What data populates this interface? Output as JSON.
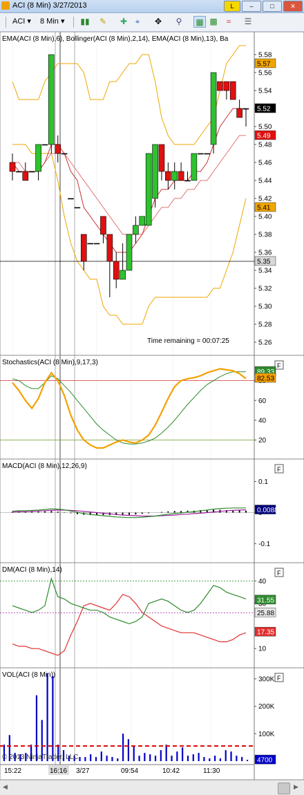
{
  "window": {
    "title": "ACI (8 Min)  3/27/2013",
    "help_label": "L"
  },
  "toolbar": {
    "instrument": "ACI",
    "interval": "8 Min"
  },
  "status": {
    "time_remaining": "Time remaining = 00:07:25",
    "copyright": "© 2013 NinjaTrader, LLC"
  },
  "colors": {
    "up": "#2ec22e",
    "down": "#e01010",
    "bollinger": "#f0a500",
    "ema6": "#c83030",
    "ema13": "#e07070",
    "stoch_k": "#f5a000",
    "stoch_d": "#2e8b2e",
    "dm_plus": "#2e8b2e",
    "dm_minus": "#e03030",
    "volume": "#0000c8",
    "vol_ma": "#e00000",
    "macd_line": "#2e8b2e",
    "macd_signal": "#a020a0"
  },
  "chart_data": {
    "type": "line",
    "x_tick_labels": [
      "15:22",
      "16:16",
      "3/27",
      "09:54",
      "10:42",
      "11:30"
    ],
    "panels": [
      {
        "name": "price",
        "label": "EMA(ACI (8 Min),6), Bollinger(ACI (8 Min),2,14), EMA(ACI (8 Min),13), Ba",
        "ylim": [
          5.25,
          5.59
        ],
        "yticks": [
          "5.58",
          "5.56",
          "5.54",
          "5.52",
          "5.50",
          "5.48",
          "5.46",
          "5.44",
          "5.42",
          "5.40",
          "5.38",
          "5.36",
          "5.34",
          "5.32",
          "5.30",
          "5.28",
          "5.26"
        ],
        "value_labels": [
          {
            "text": "5.57",
            "value": 5.57,
            "color": "#f0a500"
          },
          {
            "text": "5.52",
            "value": 5.52,
            "color": "#000000"
          },
          {
            "text": "5.49",
            "value": 5.49,
            "color": "#e01010"
          },
          {
            "text": "5.41",
            "value": 5.41,
            "color": "#f0a500"
          },
          {
            "text": "5.35",
            "value": 5.35,
            "color": "#d8d8d8"
          }
        ],
        "candles": [
          {
            "o": 5.46,
            "h": 5.47,
            "l": 5.44,
            "c": 5.45
          },
          {
            "o": 5.45,
            "h": 5.45,
            "l": 5.45,
            "c": 5.45
          },
          {
            "o": 5.45,
            "h": 5.46,
            "l": 5.44,
            "c": 5.44
          },
          {
            "o": 5.45,
            "h": 5.45,
            "l": 5.45,
            "c": 5.45
          },
          {
            "o": 5.45,
            "h": 5.48,
            "l": 5.44,
            "c": 5.48
          },
          {
            "o": 5.48,
            "h": 5.48,
            "l": 5.48,
            "c": 5.48
          },
          {
            "o": 5.48,
            "h": 5.58,
            "l": 5.47,
            "c": 5.58
          },
          {
            "o": 5.48,
            "h": 5.49,
            "l": 5.46,
            "c": 5.47
          },
          {
            "o": 5.47,
            "h": 5.47,
            "l": 5.47,
            "c": 5.47
          },
          {
            "o": 5.42,
            "h": 5.42,
            "l": 5.42,
            "c": 5.42
          },
          {
            "o": 5.41,
            "h": 5.41,
            "l": 5.41,
            "c": 5.41
          },
          {
            "o": 5.38,
            "h": 5.38,
            "l": 5.34,
            "c": 5.35
          },
          {
            "o": 5.37,
            "h": 5.37,
            "l": 5.37,
            "c": 5.37
          },
          {
            "o": 5.37,
            "h": 5.37,
            "l": 5.37,
            "c": 5.37
          },
          {
            "o": 5.4,
            "h": 5.4,
            "l": 5.37,
            "c": 5.38
          },
          {
            "o": 5.38,
            "h": 5.38,
            "l": 5.31,
            "c": 5.35
          },
          {
            "o": 5.35,
            "h": 5.36,
            "l": 5.32,
            "c": 5.33
          },
          {
            "o": 5.33,
            "h": 5.37,
            "l": 5.33,
            "c": 5.34
          },
          {
            "o": 5.34,
            "h": 5.38,
            "l": 5.34,
            "c": 5.38
          },
          {
            "o": 5.38,
            "h": 5.4,
            "l": 5.37,
            "c": 5.39
          },
          {
            "o": 5.39,
            "h": 5.4,
            "l": 5.39,
            "c": 5.4
          },
          {
            "o": 5.39,
            "h": 5.47,
            "l": 5.39,
            "c": 5.47
          },
          {
            "o": 5.42,
            "h": 5.48,
            "l": 5.41,
            "c": 5.48
          },
          {
            "o": 5.48,
            "h": 5.48,
            "l": 5.44,
            "c": 5.45
          },
          {
            "o": 5.45,
            "h": 5.46,
            "l": 5.43,
            "c": 5.44
          },
          {
            "o": 5.44,
            "h": 5.46,
            "l": 5.43,
            "c": 5.45
          },
          {
            "o": 5.45,
            "h": 5.46,
            "l": 5.44,
            "c": 5.44
          },
          {
            "o": 5.44,
            "h": 5.45,
            "l": 5.44,
            "c": 5.44
          },
          {
            "o": 5.44,
            "h": 5.47,
            "l": 5.44,
            "c": 5.47
          },
          {
            "o": 5.47,
            "h": 5.47,
            "l": 5.47,
            "c": 5.47
          },
          {
            "o": 5.47,
            "h": 5.47,
            "l": 5.47,
            "c": 5.47
          },
          {
            "o": 5.48,
            "h": 5.56,
            "l": 5.47,
            "c": 5.56
          },
          {
            "o": 5.55,
            "h": 5.55,
            "l": 5.54,
            "c": 5.54
          },
          {
            "o": 5.55,
            "h": 5.55,
            "l": 5.53,
            "c": 5.54
          },
          {
            "o": 5.55,
            "h": 5.55,
            "l": 5.53,
            "c": 5.53
          },
          {
            "o": 5.52,
            "h": 5.53,
            "l": 5.51,
            "c": 5.51
          },
          {
            "o": 5.52,
            "h": 5.52,
            "l": 5.5,
            "c": 5.52
          }
        ],
        "bollinger_upper": [
          5.55,
          5.53,
          5.53,
          5.53,
          5.53,
          5.55,
          5.56,
          5.57,
          5.57,
          5.57,
          5.57,
          5.56,
          5.53,
          5.53,
          5.53,
          5.55,
          5.55,
          5.56,
          5.57,
          5.57,
          5.58,
          5.58,
          5.55,
          5.51,
          5.49,
          5.48,
          5.48,
          5.48,
          5.48,
          5.49,
          5.5,
          5.51,
          5.54,
          5.57,
          5.58,
          5.59,
          5.59
        ],
        "bollinger_lower": [
          5.48,
          5.48,
          5.48,
          5.47,
          5.47,
          5.47,
          5.47,
          5.44,
          5.4,
          5.37,
          5.35,
          5.34,
          5.33,
          5.33,
          5.3,
          5.29,
          5.29,
          5.28,
          5.28,
          5.28,
          5.28,
          5.3,
          5.31,
          5.31,
          5.31,
          5.31,
          5.31,
          5.31,
          5.31,
          5.31,
          5.31,
          5.32,
          5.32,
          5.34,
          5.36,
          5.39,
          5.42
        ],
        "ema_6": [
          5.46,
          5.45,
          5.45,
          5.45,
          5.45,
          5.46,
          5.48,
          5.48,
          5.47,
          5.45,
          5.44,
          5.41,
          5.4,
          5.39,
          5.38,
          5.37,
          5.36,
          5.36,
          5.36,
          5.37,
          5.38,
          5.4,
          5.42,
          5.43,
          5.43,
          5.44,
          5.44,
          5.44,
          5.45,
          5.45,
          5.46,
          5.48,
          5.5,
          5.51,
          5.52,
          5.52,
          5.52
        ],
        "ema_13": [
          5.46,
          5.46,
          5.45,
          5.45,
          5.45,
          5.46,
          5.47,
          5.47,
          5.47,
          5.46,
          5.45,
          5.44,
          5.43,
          5.42,
          5.41,
          5.4,
          5.39,
          5.38,
          5.38,
          5.38,
          5.38,
          5.39,
          5.4,
          5.41,
          5.41,
          5.42,
          5.42,
          5.43,
          5.43,
          5.44,
          5.44,
          5.45,
          5.46,
          5.47,
          5.48,
          5.49,
          5.49
        ],
        "horizontal_line": 5.35
      },
      {
        "name": "stochastics",
        "label": "Stochastics(ACI (8 Min),9,17,3)",
        "ylim": [
          5,
          100
        ],
        "yticks": [
          "80",
          "60",
          "40",
          "20"
        ],
        "value_labels": [
          {
            "text": "89.33",
            "value": 89.33,
            "color": "#2e8b2e"
          },
          {
            "text": "82.53",
            "value": 82.53,
            "color": "#f5a000"
          }
        ],
        "levels": [
          80,
          20
        ],
        "k": [
          78,
          70,
          60,
          52,
          62,
          78,
          88,
          80,
          65,
          45,
          30,
          20,
          15,
          12,
          12,
          15,
          18,
          20,
          18,
          17,
          20,
          25,
          35,
          48,
          62,
          74,
          80,
          82,
          83,
          85,
          88,
          90,
          92,
          91,
          90,
          87,
          82
        ],
        "d": [
          82,
          80,
          75,
          72,
          72,
          78,
          85,
          82,
          75,
          68,
          60,
          52,
          44,
          36,
          30,
          25,
          20,
          17,
          16,
          16,
          17,
          19,
          22,
          27,
          33,
          40,
          48,
          56,
          63,
          70,
          76,
          80,
          84,
          87,
          89,
          89,
          89
        ]
      },
      {
        "name": "macd",
        "label": "MACD(ACI (8 Min),12,26,9)",
        "ylim": [
          -0.15,
          0.15
        ],
        "yticks": [
          "0.1",
          "0",
          "-0.1"
        ],
        "value_labels": [
          {
            "text": "0.00881",
            "value": 0.00881,
            "color": "#00007a"
          }
        ],
        "macd": [
          0.005,
          0.006,
          0.006,
          0.007,
          0.008,
          0.01,
          0.012,
          0.011,
          0.009,
          0.005,
          0.001,
          -0.003,
          -0.006,
          -0.008,
          -0.01,
          -0.012,
          -0.014,
          -0.015,
          -0.016,
          -0.016,
          -0.015,
          -0.013,
          -0.011,
          -0.008,
          -0.005,
          -0.003,
          -0.001,
          0.001,
          0.003,
          0.006,
          0.008,
          0.011,
          0.013,
          0.014,
          0.015,
          0.015,
          0.015
        ],
        "signal": [
          0.002,
          0.003,
          0.003,
          0.004,
          0.005,
          0.006,
          0.007,
          0.008,
          0.008,
          0.007,
          0.006,
          0.004,
          0.002,
          0.0,
          -0.002,
          -0.004,
          -0.006,
          -0.008,
          -0.009,
          -0.01,
          -0.011,
          -0.011,
          -0.011,
          -0.01,
          -0.009,
          -0.008,
          -0.006,
          -0.005,
          -0.003,
          -0.002,
          0.0,
          0.002,
          0.004,
          0.006,
          0.007,
          0.008,
          0.009
        ]
      },
      {
        "name": "dm",
        "label": "DM(ACI (8 Min),14)",
        "ylim": [
          3,
          45
        ],
        "yticks": [
          "40",
          "30",
          "10"
        ],
        "value_labels": [
          {
            "text": "31.55",
            "value": 31.55,
            "color": "#2e8b2e"
          },
          {
            "text": "25.88",
            "value": 25.88,
            "color": "#e8e8e8"
          },
          {
            "text": "17.35",
            "value": 17.35,
            "color": "#e03030"
          }
        ],
        "levels": [
          40,
          25.88
        ],
        "dm_plus": [
          29,
          28,
          27,
          26,
          27,
          29,
          41,
          33,
          32,
          30,
          29,
          28,
          27,
          27,
          26,
          24,
          23,
          22,
          21,
          22,
          24,
          30,
          31,
          32,
          31,
          29,
          27,
          26,
          27,
          30,
          34,
          38,
          37,
          35,
          34,
          33,
          32
        ],
        "dm_minus": [
          12,
          11,
          11,
          10,
          10,
          9,
          8,
          7,
          9,
          16,
          22,
          29,
          30,
          29,
          28,
          27,
          30,
          34,
          33,
          30,
          26,
          24,
          22,
          20,
          19,
          18,
          17,
          17,
          17,
          16,
          15,
          14,
          13,
          13,
          14,
          16,
          17
        ]
      },
      {
        "name": "volume",
        "label": "VOL(ACI (8 Min))",
        "ylim": [
          0,
          320000
        ],
        "yticks": [
          "300K",
          "200K",
          "100K"
        ],
        "value_labels": [
          {
            "text": "4700",
            "value": 4700,
            "color": "#0000c8"
          }
        ],
        "ma_level": 55000,
        "values": [
          60000,
          95000,
          30000,
          25000,
          30000,
          60000,
          240000,
          150000,
          320000,
          310000,
          60000,
          40000,
          20000,
          20000,
          15000,
          15000,
          25000,
          15000,
          35000,
          20000,
          15000,
          10000,
          100000,
          80000,
          55000,
          20000,
          30000,
          25000,
          20000,
          40000,
          60000,
          20000,
          35000,
          50000,
          20000,
          25000,
          30000,
          15000,
          10000,
          20000,
          10000,
          40000,
          35000,
          20000,
          15000,
          4700
        ]
      }
    ]
  }
}
